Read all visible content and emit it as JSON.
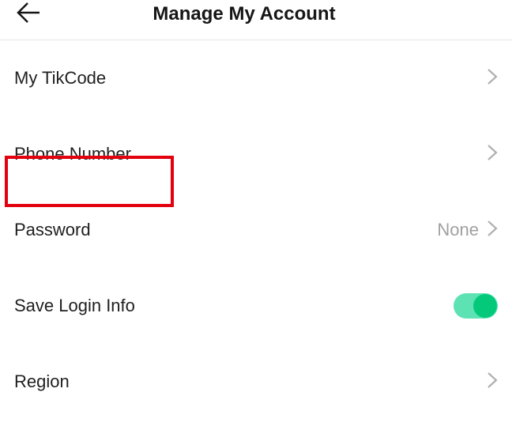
{
  "header": {
    "title": "Manage My Account"
  },
  "items": {
    "tikcode": {
      "label": "My TikCode"
    },
    "phone": {
      "label": "Phone Number"
    },
    "password": {
      "label": "Password",
      "value": "None"
    },
    "savelogin": {
      "label": "Save Login Info",
      "toggled": true
    },
    "region": {
      "label": "Region"
    }
  }
}
